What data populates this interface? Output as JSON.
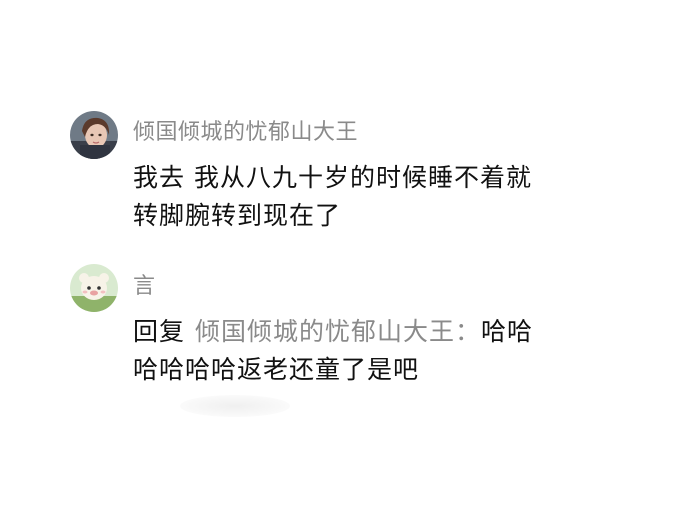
{
  "comments": [
    {
      "username": "倾国倾城的忧郁山大王",
      "text_line1": "我去 我从八九十岁的时候睡不着就",
      "text_line2": "转脚腕转到现在了"
    },
    {
      "username": "言",
      "reply_prefix": "回复",
      "reply_target": "倾国倾城的忧郁山大王",
      "reply_separator": "：",
      "reply_text_line1_end": "哈哈",
      "reply_text_line2": "哈哈哈哈返老还童了是吧"
    }
  ],
  "colors": {
    "username": "#8a8a8a",
    "text": "#111111",
    "background": "#ffffff"
  }
}
